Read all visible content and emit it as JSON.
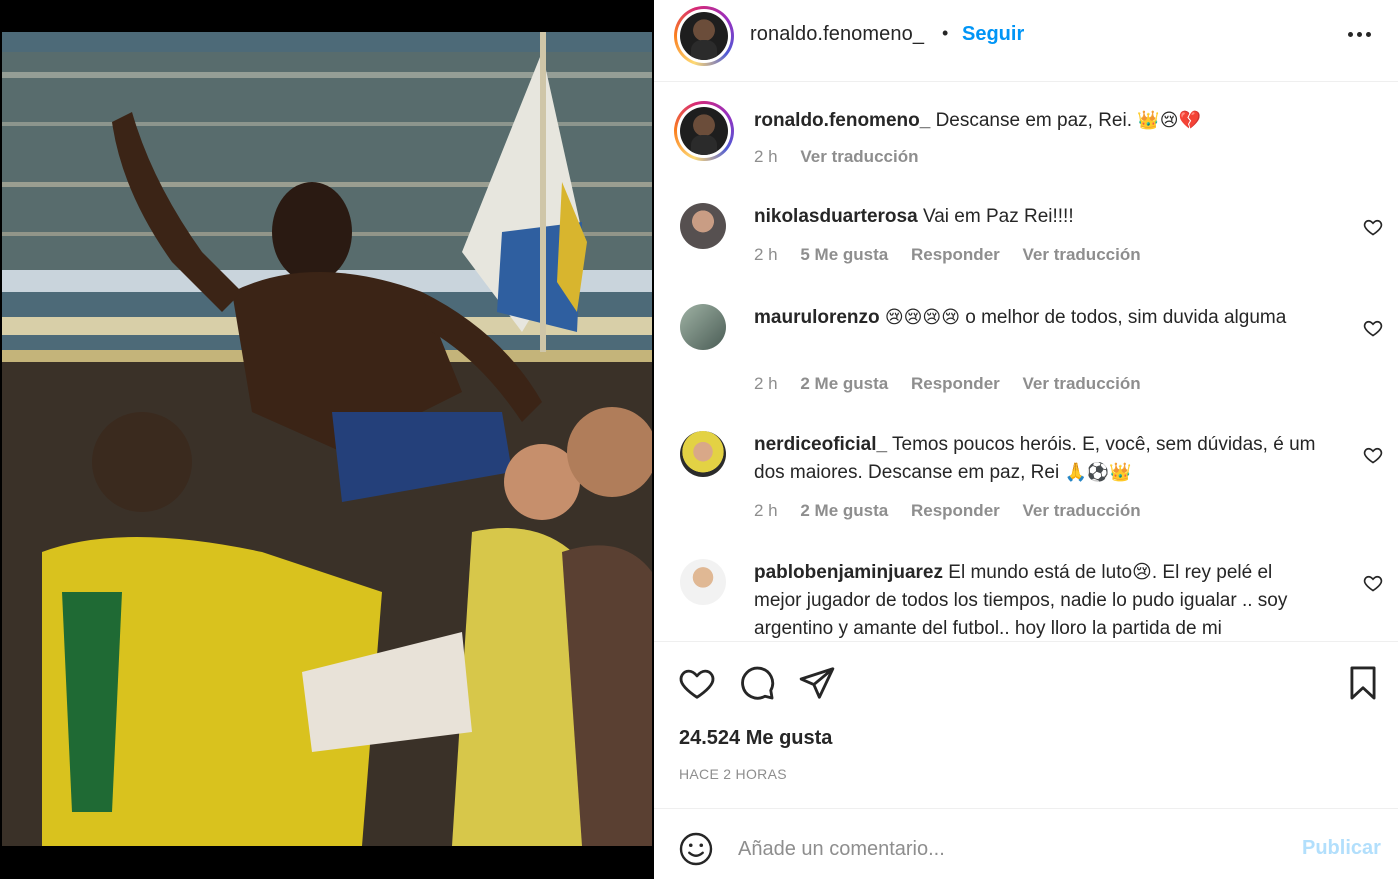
{
  "post": {
    "username": "ronaldo.fenomeno_",
    "follow_label": "Seguir",
    "separator": "•",
    "caption": {
      "username": "ronaldo.fenomeno_",
      "text": "Descanse em paz, Rei.",
      "emojis": "👑😢💔",
      "time": "2 h",
      "translate": "Ver traducción"
    }
  },
  "comments": [
    {
      "username": "nikolasduarterosa",
      "text": "Vai em Paz Rei!!!!",
      "time": "2 h",
      "likes": "5 Me gusta",
      "reply": "Responder",
      "translate": "Ver traducción"
    },
    {
      "username": "maurulorenzo",
      "emojis": "😢😢😢😢",
      "text": "o melhor de todos, sim duvida alguma",
      "time": "2 h",
      "likes": "2 Me gusta",
      "reply": "Responder",
      "translate": "Ver traducción"
    },
    {
      "username": "nerdiceoficial_",
      "text": "Temos poucos heróis. E, você, sem dúvidas, é um dos maiores. Descanse em paz, Rei",
      "emojis": "🙏⚽👑",
      "time": "2 h",
      "likes": "2 Me gusta",
      "reply": "Responder",
      "translate": "Ver traducción"
    },
    {
      "username": "pablobenjaminjuarez",
      "text": "El mundo está de luto😢. El rey pelé el mejor jugador de todos los tiempos, nadie lo pudo igualar .. soy argentino y amante del futbol.. hoy lloro la partida de mi"
    }
  ],
  "actions": {
    "icons": [
      "heart-icon",
      "comment-icon",
      "share-icon",
      "bookmark-icon"
    ],
    "likes_count": "24.524 Me gusta",
    "time_ago": "HACE 2 HORAS"
  },
  "comment_box": {
    "placeholder": "Añade un comentario...",
    "publish_label": "Publicar"
  },
  "colors": {
    "accent": "#0095f6",
    "publish_disabled": "#b2dffc",
    "muted": "#8e8e8e",
    "text": "#262626"
  }
}
